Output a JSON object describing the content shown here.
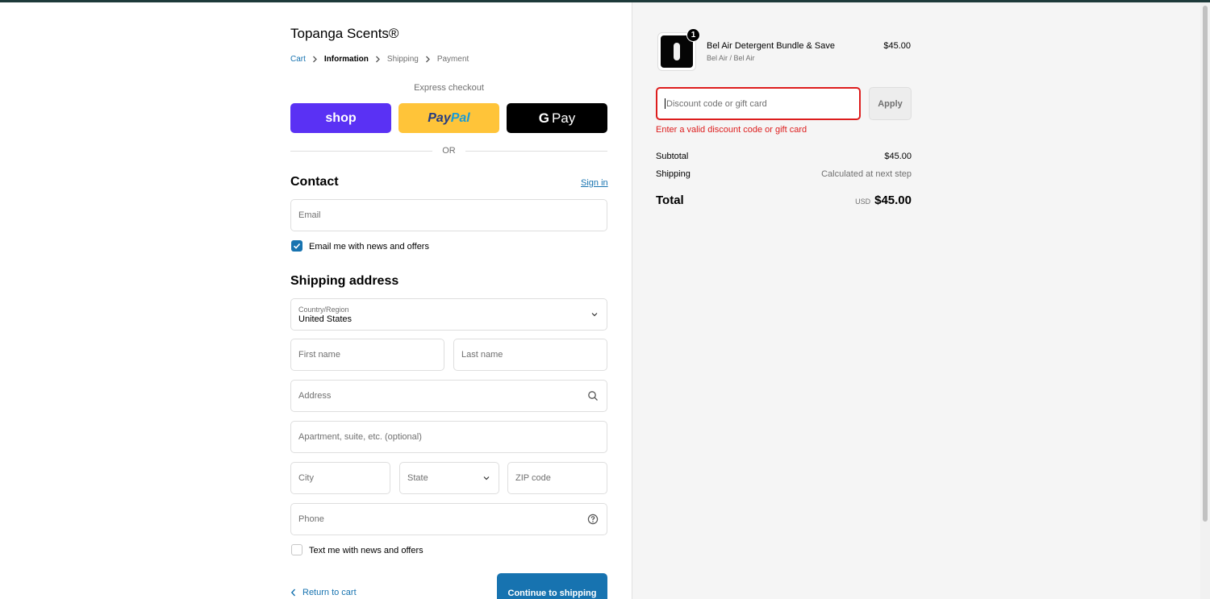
{
  "store": {
    "name": "Topanga Scents®"
  },
  "breadcrumb": [
    "Cart",
    "Information",
    "Shipping",
    "Payment"
  ],
  "express": {
    "label": "Express checkout",
    "shop_label": "shop",
    "paypal_label_a": "Pay",
    "paypal_label_b": "Pal",
    "gpay_g": "G",
    "gpay_label": "Pay",
    "or_label": "OR"
  },
  "contact": {
    "title": "Contact",
    "signin_label": "Sign in",
    "email_placeholder": "Email",
    "email_news_label": "Email me with news and offers",
    "email_news_checked": true
  },
  "shipping": {
    "title": "Shipping address",
    "country_label": "Country/Region",
    "country_value": "United States",
    "first_name": "First name",
    "last_name": "Last name",
    "address": "Address",
    "apartment": "Apartment, suite, etc. (optional)",
    "city": "City",
    "state": "State",
    "zip": "ZIP code",
    "phone": "Phone",
    "text_news_label": "Text me with news and offers",
    "text_news_checked": false
  },
  "actions": {
    "return_label": "Return to cart",
    "continue_label": "Continue to shipping"
  },
  "summary": {
    "product_name": "Bel Air Detergent Bundle & Save",
    "product_variant": "Bel Air / Bel Air",
    "product_price": "$45.00",
    "quantity": "1",
    "discount_placeholder": "Discount code or gift card",
    "apply_label": "Apply",
    "error_text": "Enter a valid discount code or gift card",
    "subtotal_label": "Subtotal",
    "subtotal_value": "$45.00",
    "shipping_label": "Shipping",
    "shipping_value": "Calculated at next step",
    "total_label": "Total",
    "currency": "USD",
    "total_value": "$45.00"
  },
  "colors": {
    "accent": "#1773b0",
    "error": "#dd1d1d",
    "shop_pay": "#5a31f4",
    "paypal": "#ffc439"
  }
}
